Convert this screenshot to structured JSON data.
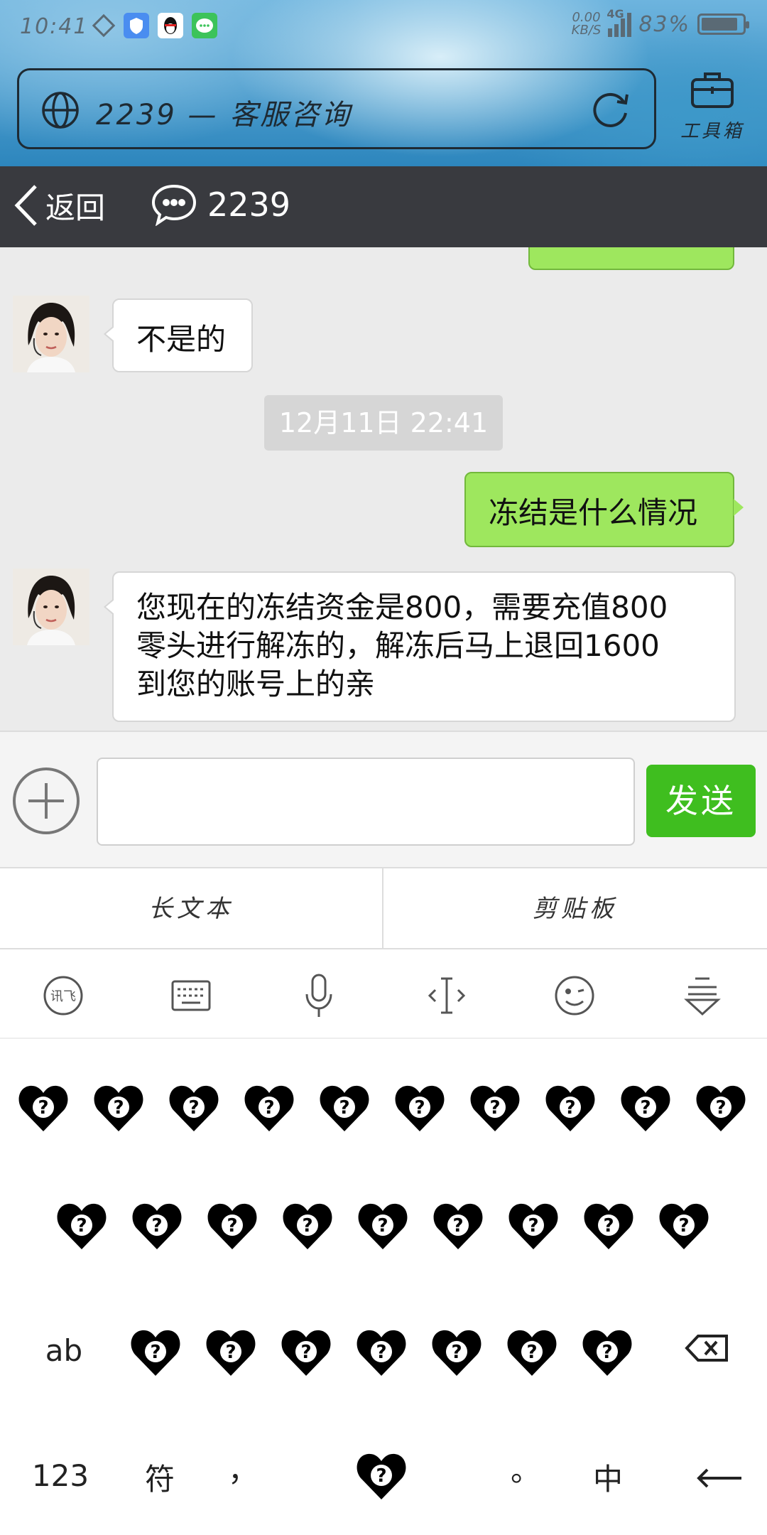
{
  "status": {
    "time": "10:41",
    "net_speed": "0.00",
    "net_unit": "KB/S",
    "network": "4G",
    "battery": "83%"
  },
  "browser": {
    "url_text": "2239 — 客服咨询",
    "toolbox_label": "工具箱"
  },
  "header": {
    "back_label": "返回",
    "chat_id": "2239"
  },
  "messages": [
    {
      "from": "agent",
      "text": "不是的"
    },
    {
      "timestamp": "12月11日 22:41"
    },
    {
      "from": "user",
      "text": "冻结是什么情况"
    },
    {
      "from": "agent",
      "lines": [
        "您现在的冻结资金是800，需要充值800",
        "零头进行解冻的，解冻后马上退回1600",
        "到您的账号上的亲"
      ]
    }
  ],
  "input": {
    "value": "",
    "send_label": "发送"
  },
  "keyboard": {
    "long_text": "长文本",
    "clipboard": "剪贴板",
    "tools": [
      "xunfei-icon",
      "keyboard-icon",
      "microphone-icon",
      "cursor-icon",
      "emoji-icon",
      "collapse-icon"
    ],
    "xunfei_label": "讯飞",
    "ab_label": "ab",
    "num_label": "123",
    "symbol_label": "符",
    "comma": "，",
    "period": "。",
    "lang_label": "中"
  },
  "colors": {
    "header_bg": "#393a3f",
    "user_bubble": "#9ee75e",
    "send_button": "#3fbe1f"
  }
}
